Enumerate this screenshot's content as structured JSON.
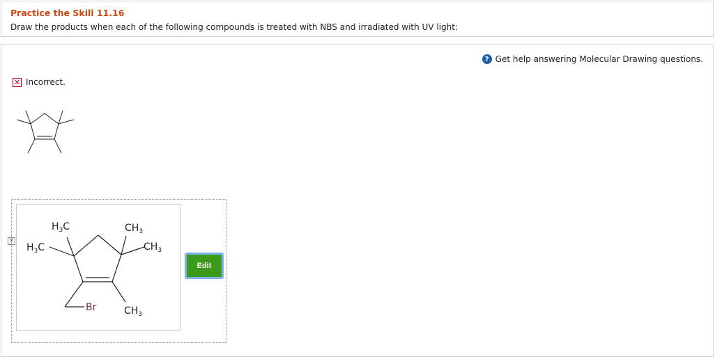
{
  "question": {
    "title": "Practice the Skill 11.16",
    "prompt": "Draw the products when each of the following compounds is treated with NBS and irradiated with UV light:"
  },
  "help": {
    "icon": "question-circle-icon",
    "text": "Get help answering Molecular Drawing questions."
  },
  "feedback": {
    "icon": "x-box-icon",
    "status": "Incorrect."
  },
  "answer": {
    "labels": {
      "h3c_top": "H3C",
      "h3c_left": "H3C",
      "ch3_top": "CH3",
      "ch3_right": "CH3",
      "ch3_bottom": "CH3",
      "br": "Br"
    },
    "edit_label": "Edit"
  },
  "colors": {
    "title": "#c94a12",
    "edit_button": "#3c9a1a",
    "incorrect": "#d0021b",
    "help_icon": "#1e5ea8"
  }
}
